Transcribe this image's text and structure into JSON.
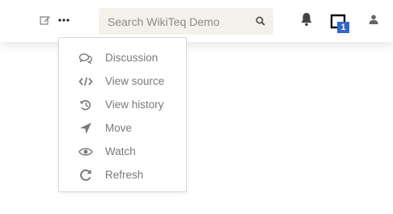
{
  "header": {
    "edit_icon": "edit-icon",
    "more_icon": "ellipsis-icon",
    "search": {
      "placeholder": "Search WikiTeq Demo",
      "value": "",
      "icon": "search-icon"
    },
    "bell_icon": "bell-icon",
    "notifications": {
      "icon": "notice-tray-icon",
      "count": "1",
      "badge_color": "#3366cc"
    },
    "user_icon": "user-icon"
  },
  "menu": {
    "items": [
      {
        "label": "Discussion",
        "icon": "discussion-icon"
      },
      {
        "label": "View source",
        "icon": "code-icon"
      },
      {
        "label": "View history",
        "icon": "history-icon"
      },
      {
        "label": "Move",
        "icon": "move-icon"
      },
      {
        "label": "Watch",
        "icon": "eye-icon"
      },
      {
        "label": "Refresh",
        "icon": "refresh-icon"
      }
    ]
  },
  "colors": {
    "icon": "#7a7a7a",
    "menu_text": "#7a7a7a",
    "search_bg": "#f4f1ea",
    "accent": "#3366cc"
  }
}
